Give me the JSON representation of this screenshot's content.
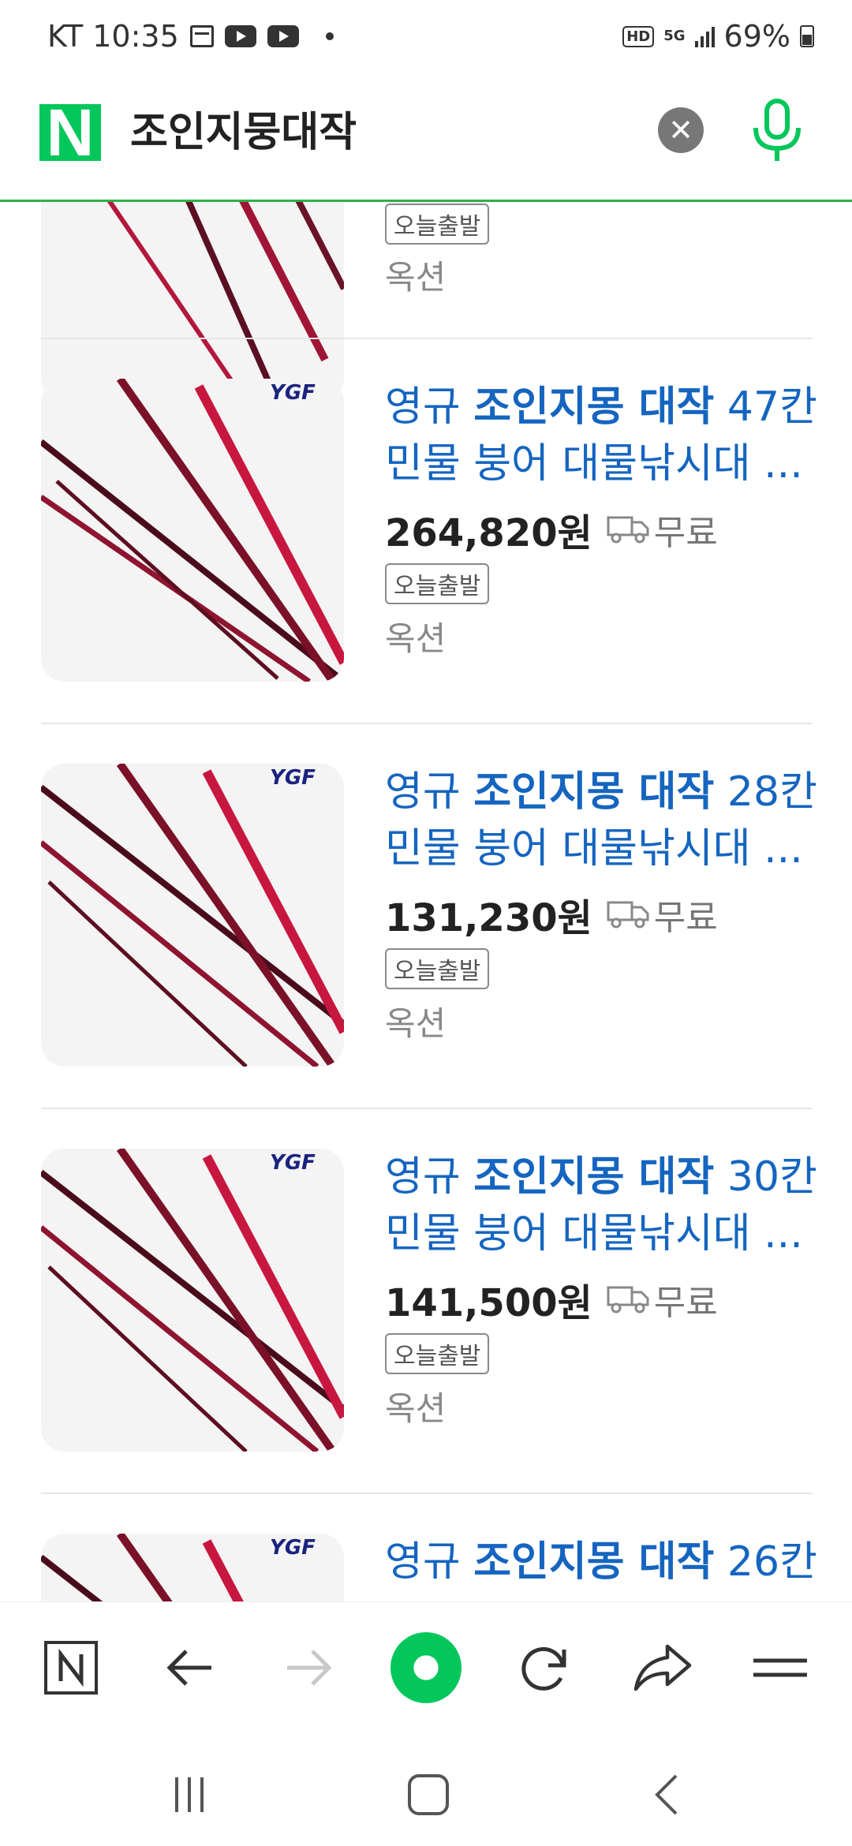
{
  "status_bar": {
    "carrier_time": "KT 10:35",
    "hd": "HD",
    "network": "5G",
    "battery": "69%"
  },
  "search": {
    "logo": "N",
    "query": "조인지뭉대작",
    "clear_icon": "close-icon",
    "voice_icon": "mic-icon",
    "brand_color": "#03c75a"
  },
  "products": [
    {
      "title_prefix": "",
      "title_bold": "",
      "title_suffix": "",
      "title_line2": "",
      "price": "",
      "shipping": "",
      "badge": "오늘출발",
      "seller": "옥션",
      "partial": "top"
    },
    {
      "title_prefix": "영규 ",
      "title_bold": "조인지몽 대작",
      "title_suffix": " 47칸",
      "title_line2": "민물 붕어 대물낚시대 ...",
      "price": "264,820원",
      "shipping": "무료",
      "badge": "오늘출발",
      "seller": "옥션",
      "brand_mark": "YGF"
    },
    {
      "title_prefix": "영규 ",
      "title_bold": "조인지몽 대작",
      "title_suffix": " 28칸",
      "title_line2": "민물 붕어 대물낚시대 ...",
      "price": "131,230원",
      "shipping": "무료",
      "badge": "오늘출발",
      "seller": "옥션",
      "brand_mark": "YGF"
    },
    {
      "title_prefix": "영규 ",
      "title_bold": "조인지몽 대작",
      "title_suffix": " 30칸",
      "title_line2": "민물 붕어 대물낚시대 ...",
      "price": "141,500원",
      "shipping": "무료",
      "badge": "오늘출발",
      "seller": "옥션",
      "brand_mark": "YGF"
    },
    {
      "title_prefix": "영규 ",
      "title_bold": "조인지몽 대작",
      "title_suffix": " 26칸",
      "title_line2": "",
      "price": "",
      "shipping": "",
      "badge": "",
      "seller": "",
      "brand_mark": "YGF",
      "partial": "bottom"
    }
  ],
  "bottom_nav": {
    "home_icon": "naver-n-icon",
    "back_icon": "arrow-left-icon",
    "forward_icon": "arrow-right-icon",
    "green_dot_icon": "green-dot-icon",
    "refresh_icon": "refresh-icon",
    "share_icon": "share-icon",
    "menu_icon": "menu-icon",
    "green_dot_color": "#03c75a"
  },
  "system_nav": {
    "recents_icon": "recents-icon",
    "home_icon": "home-icon",
    "back_icon": "back-icon"
  }
}
